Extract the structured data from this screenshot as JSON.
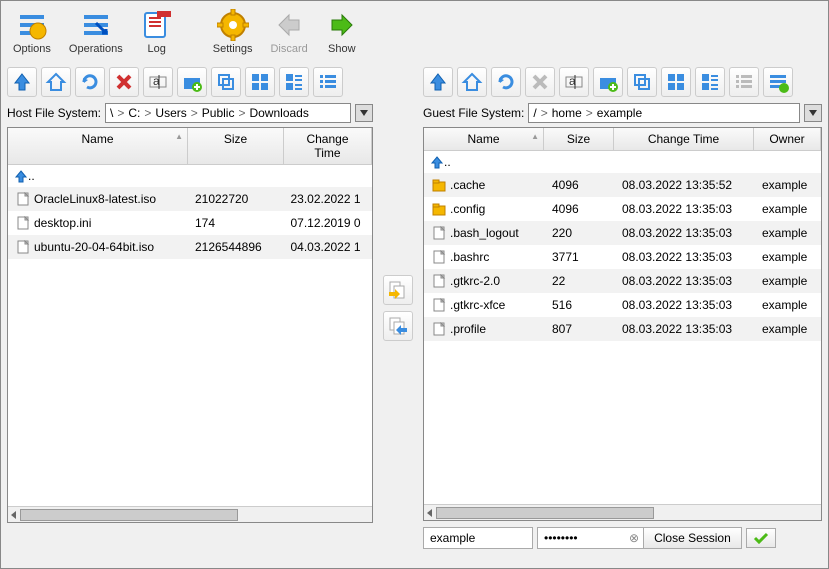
{
  "mainToolbar": {
    "options": "Options",
    "operations": "Operations",
    "log": "Log",
    "settings": "Settings",
    "discard": "Discard",
    "show": "Show"
  },
  "host": {
    "label": "Host File System:",
    "path": [
      "\\",
      "C:",
      "Users",
      "Public",
      "Downloads"
    ],
    "columns": {
      "name": "Name",
      "size": "Size",
      "change": "Change Time"
    },
    "upLabel": "..",
    "rows": [
      {
        "icon": "file",
        "name": "OracleLinux8-latest.iso",
        "size": "21022720",
        "change": "23.02.2022 1"
      },
      {
        "icon": "file",
        "name": "desktop.ini",
        "size": "174",
        "change": "07.12.2019 0"
      },
      {
        "icon": "file",
        "name": "ubuntu-20-04-64bit.iso",
        "size": "2126544896",
        "change": "04.03.2022 1"
      }
    ]
  },
  "guest": {
    "label": "Guest File System:",
    "path": [
      "/",
      "home",
      "example"
    ],
    "columns": {
      "name": "Name",
      "size": "Size",
      "change": "Change Time",
      "owner": "Owner"
    },
    "upLabel": "..",
    "rows": [
      {
        "icon": "folder",
        "name": ".cache",
        "size": "4096",
        "change": "08.03.2022 13:35:52",
        "owner": "example"
      },
      {
        "icon": "folder",
        "name": ".config",
        "size": "4096",
        "change": "08.03.2022 13:35:03",
        "owner": "example"
      },
      {
        "icon": "file",
        "name": ".bash_logout",
        "size": "220",
        "change": "08.03.2022 13:35:03",
        "owner": "example"
      },
      {
        "icon": "file",
        "name": ".bashrc",
        "size": "3771",
        "change": "08.03.2022 13:35:03",
        "owner": "example"
      },
      {
        "icon": "file",
        "name": ".gtkrc-2.0",
        "size": "22",
        "change": "08.03.2022 13:35:03",
        "owner": "example"
      },
      {
        "icon": "file",
        "name": ".gtkrc-xfce",
        "size": "516",
        "change": "08.03.2022 13:35:03",
        "owner": "example"
      },
      {
        "icon": "file",
        "name": ".profile",
        "size": "807",
        "change": "08.03.2022 13:35:03",
        "owner": "example"
      }
    ]
  },
  "session": {
    "user": "example",
    "passwordMask": "••••••••",
    "closeLabel": "Close Session"
  }
}
